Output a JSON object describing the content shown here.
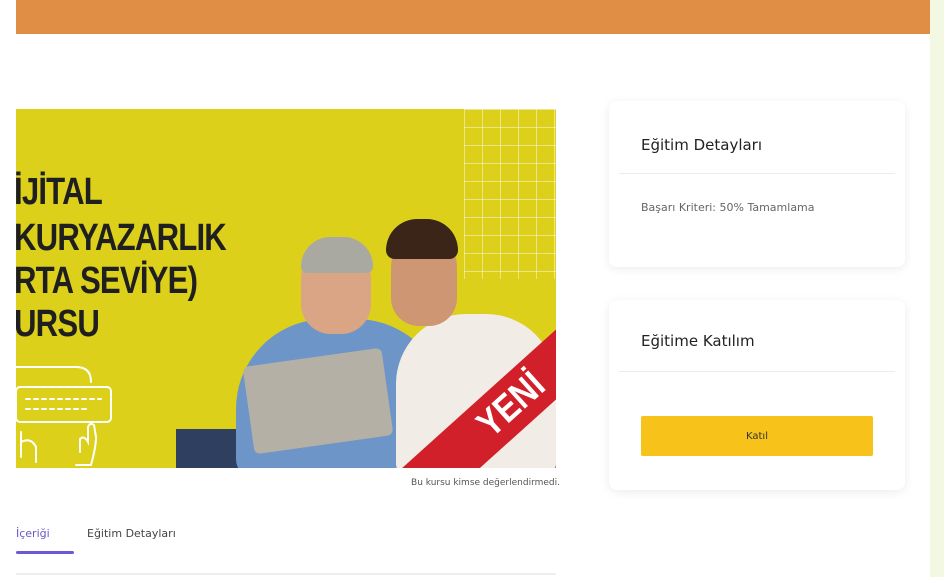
{
  "header": {
    "bar_color": "#e08d46"
  },
  "course": {
    "image_title_lines": [
      "İJİTAL",
      "KURYAZARLIK",
      "RTA SEVİYE)",
      "URSU"
    ],
    "ribbon_label": "YENİ",
    "rating_text": "Bu kursu kimse değerlendirmedi."
  },
  "tabs": [
    {
      "label": "İçeriği",
      "active": true
    },
    {
      "label": "Eğitim Detayları",
      "active": false
    }
  ],
  "details_card": {
    "title": "Eğitim Detayları",
    "criteria_label": "Başarı Kriteri:",
    "criteria_value": "50% Tamamlama"
  },
  "join_card": {
    "title": "Eğitime Katılım",
    "button_label": "Katıl"
  },
  "colors": {
    "accent": "#f7c21a",
    "tab_active": "#6a5ad6",
    "image_bg": "#ddd01b",
    "ribbon": "#d1202a"
  }
}
